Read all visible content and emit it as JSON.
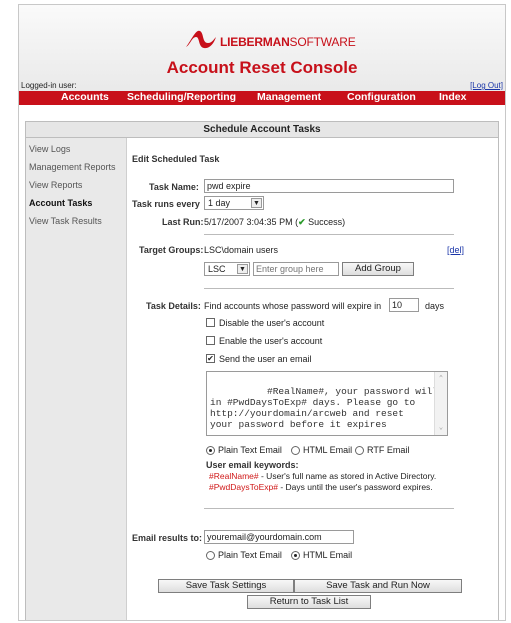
{
  "header": {
    "brand_bold": "LIEBERMAN",
    "brand_soft": "SOFTWARE",
    "console_title": "Account Reset Console",
    "logged_in_label": "Logged-in user:",
    "logout_link": "[Log Out]"
  },
  "nav": {
    "accounts": "Accounts",
    "scheduling": "Scheduling/Reporting",
    "management": "Management",
    "configuration": "Configuration",
    "index": "Index"
  },
  "panel": {
    "title": "Schedule Account Tasks"
  },
  "sidebar": {
    "items": [
      {
        "label": "View Logs"
      },
      {
        "label": "Management Reports"
      },
      {
        "label": "View Reports"
      },
      {
        "label": "Account Tasks"
      },
      {
        "label": "View Task Results"
      }
    ]
  },
  "form": {
    "section_title": "Edit Scheduled Task",
    "task_name_label": "Task Name:",
    "task_name_value": "pwd expire",
    "runs_every_label": "Task runs every",
    "runs_every_value": "1 day",
    "last_run_label": "Last Run:",
    "last_run_value": "5/17/2007 3:04:35 PM (",
    "last_run_status": "Success",
    "last_run_close": ")",
    "target_groups_label": "Target Groups:",
    "target_groups_value": "LSC\\domain users",
    "del_link": "[del]",
    "domain_select": "LSC",
    "group_placeholder": "Enter group here",
    "add_group_button": "Add Group",
    "task_details_label": "Task Details:",
    "task_details_prefix": "Find accounts whose password will expire in",
    "days_value": "10",
    "days_suffix": "days",
    "disable_label": "Disable the user's account",
    "enable_label": "Enable the user's account",
    "send_email_label": "Send the user an email",
    "email_body": "#RealName#, your password will expire\nin #PwdDaysToExp# days. Please go to\nhttp://yourdomain/arcweb and reset\nyour password before it expires",
    "plain_text_email": "Plain Text Email",
    "html_email": "HTML Email",
    "rtf_email": "RTF Email",
    "keywords_title": "User email keywords:",
    "kw1_token": "#RealName#",
    "kw1_desc": " - User's full name as stored in Active Directory.",
    "kw2_token": "#PwdDaysToExp#",
    "kw2_desc": " - Days until the user's password expires.",
    "email_results_label": "Email results to:",
    "email_results_value": "youremail@yourdomain.com",
    "results_plain": "Plain Text Email",
    "results_html": "HTML Email",
    "save_button": "Save Task Settings",
    "save_run_button": "Save Task and Run Now",
    "return_button": "Return to Task List"
  },
  "colors": {
    "brand_red": "#c7101a",
    "link_blue": "#1a35a8",
    "success_green": "#2a9a2a"
  }
}
